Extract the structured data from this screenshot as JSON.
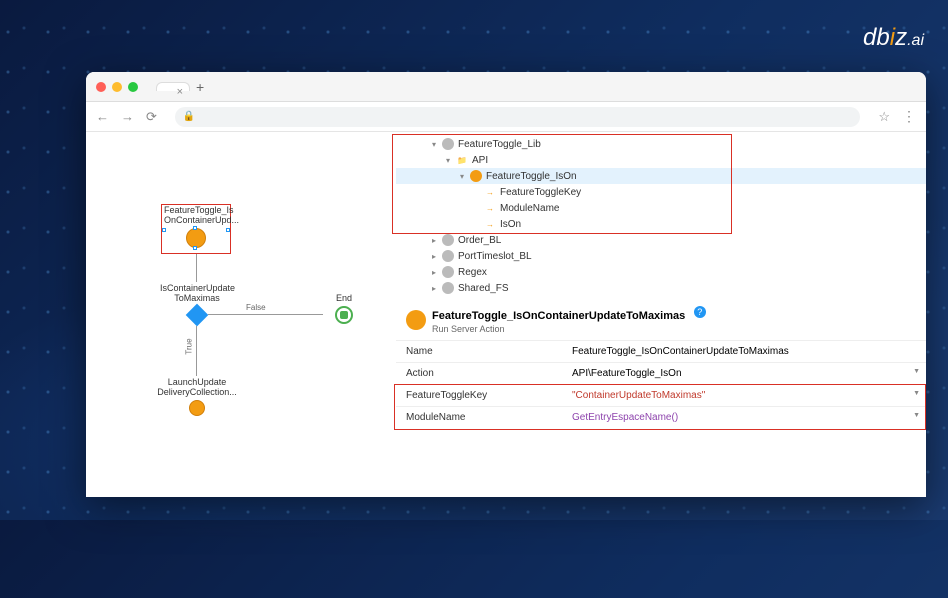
{
  "logo": "dbiz.ai",
  "browser": {
    "tab_title": " ",
    "new_tab": "+",
    "close_tab": "×"
  },
  "flow": {
    "node1": "FeatureToggle_Is\nOnContainerUpd...",
    "node2": "IsContainerUpdate\nToMaximas",
    "node3": "End",
    "node4": "LaunchUpdate\nDeliveryCollection...",
    "edge_false": "False",
    "edge_true": "True"
  },
  "tree": {
    "items": [
      {
        "depth": 2,
        "arrow": "▾",
        "icon": "gray",
        "label": "FeatureToggle_Lib"
      },
      {
        "depth": 3,
        "arrow": "▾",
        "icon": "folder",
        "label": "API"
      },
      {
        "depth": 4,
        "arrow": "▾",
        "icon": "orange",
        "label": "FeatureToggle_IsOn",
        "sel": true
      },
      {
        "depth": 5,
        "arrow": "",
        "icon": "param",
        "label": "FeatureToggleKey"
      },
      {
        "depth": 5,
        "arrow": "",
        "icon": "param",
        "label": "ModuleName"
      },
      {
        "depth": 5,
        "arrow": "",
        "icon": "param",
        "label": "IsOn"
      },
      {
        "depth": 2,
        "arrow": "▸",
        "icon": "gray",
        "label": "Order_BL"
      },
      {
        "depth": 2,
        "arrow": "▸",
        "icon": "gray",
        "label": "PortTimeslot_BL"
      },
      {
        "depth": 2,
        "arrow": "▸",
        "icon": "link",
        "label": "Regex"
      },
      {
        "depth": 2,
        "arrow": "▸",
        "icon": "gray",
        "label": "Shared_FS"
      }
    ]
  },
  "detail": {
    "title": "FeatureToggle_IsOnContainerUpdateToMaximas",
    "subtitle": "Run Server Action",
    "props": [
      {
        "label": "Name",
        "value": "FeatureToggle_IsOnContainerUpdateToMaximas",
        "cls": ""
      },
      {
        "label": "Action",
        "value": "API\\FeatureToggle_IsOn",
        "cls": "",
        "dd": true
      },
      {
        "label": "FeatureToggleKey",
        "value": "\"ContainerUpdateToMaximas\"",
        "cls": "red",
        "dd": true
      },
      {
        "label": "ModuleName",
        "value": "GetEntryEspaceName()",
        "cls": "purple",
        "dd": true
      }
    ]
  }
}
